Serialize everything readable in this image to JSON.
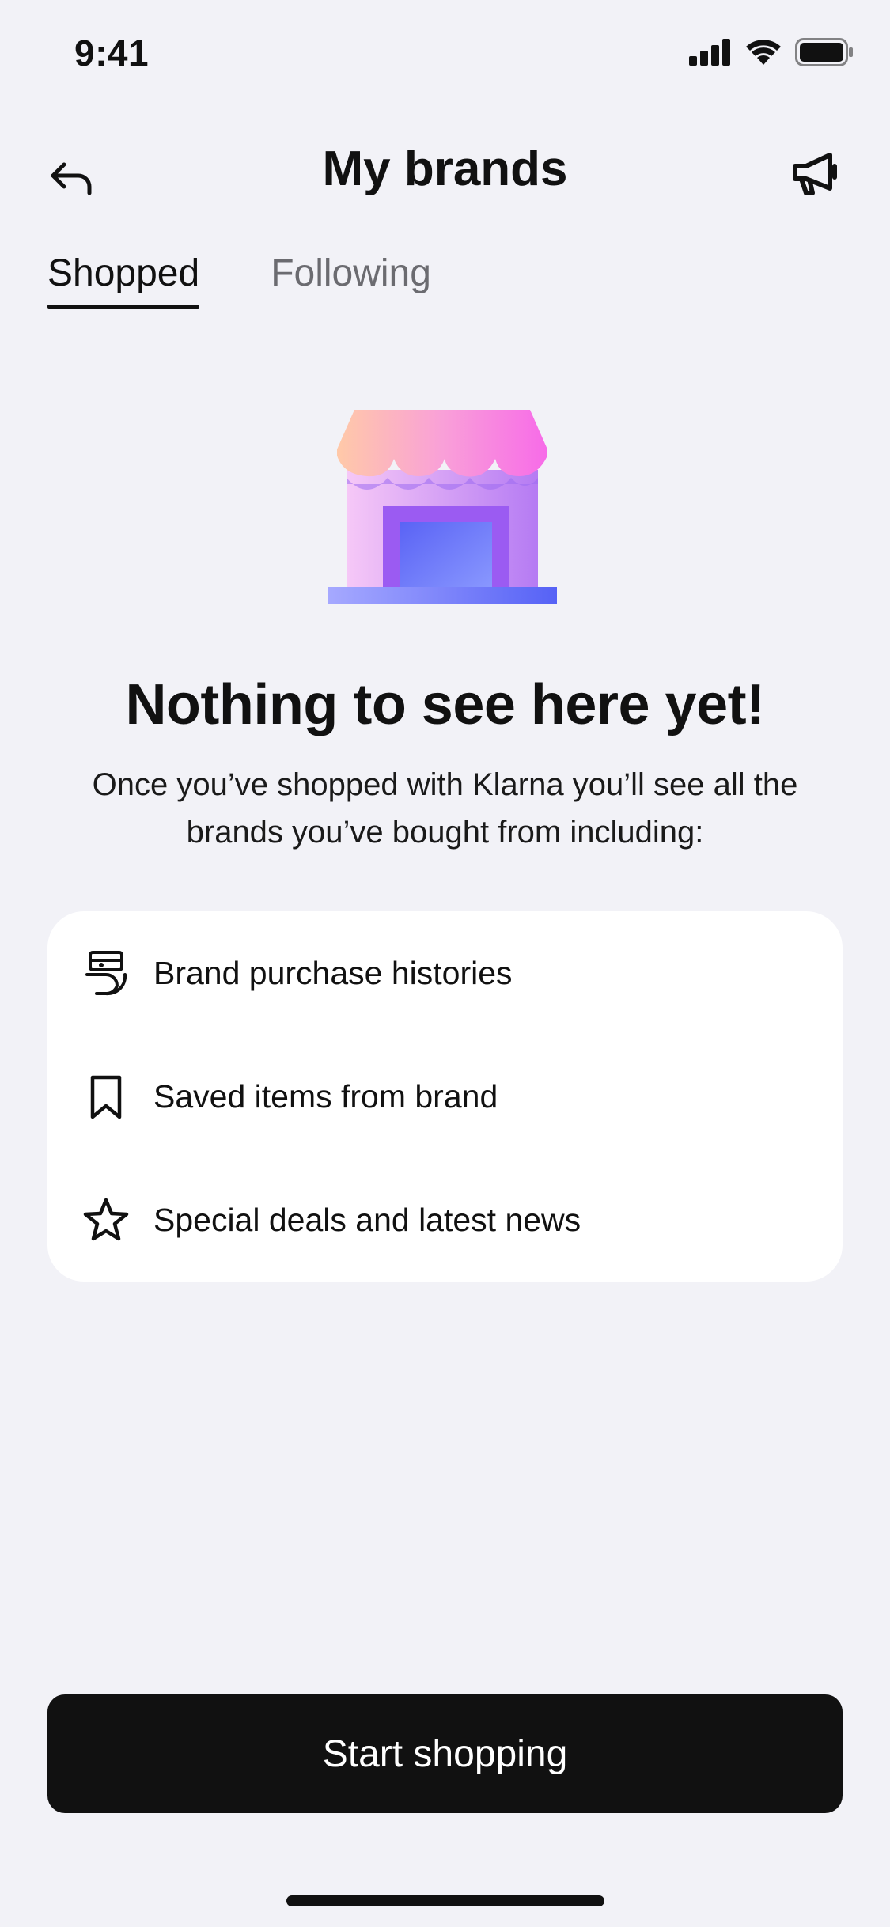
{
  "status_bar": {
    "time": "9:41"
  },
  "nav": {
    "title": "My brands"
  },
  "tabs": [
    {
      "label": "Shopped",
      "active": true
    },
    {
      "label": "Following",
      "active": false
    }
  ],
  "empty_state": {
    "title": "Nothing to see here yet!",
    "description": "Once you’ve shopped with Klarna you’ll see all the brands you’ve bought from including:"
  },
  "features": [
    {
      "icon": "receipt-icon",
      "label": "Brand purchase histories"
    },
    {
      "icon": "bookmark-icon",
      "label": "Saved items from brand"
    },
    {
      "icon": "star-icon",
      "label": "Special deals and latest news"
    }
  ],
  "cta": {
    "label": "Start shopping"
  },
  "colors": {
    "background": "#F2F2F7",
    "card": "#FFFFFF",
    "button": "#111111",
    "accent_pink": "#F47AE6",
    "accent_purple": "#A86CF6",
    "accent_blue": "#5B6CFF"
  }
}
